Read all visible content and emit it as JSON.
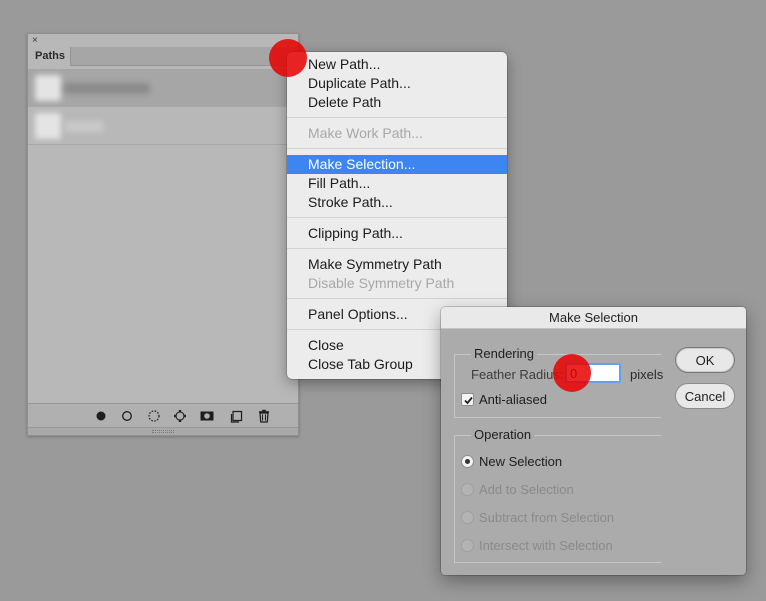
{
  "panel": {
    "close_glyph": "×",
    "tab_label": "Paths",
    "footer_icons": [
      "fill-path-icon",
      "stroke-path-icon",
      "load-selection-icon",
      "make-work-path-icon",
      "add-mask-icon",
      "new-path-icon",
      "trash-icon"
    ]
  },
  "menu": {
    "items": [
      {
        "label": "New Path...",
        "state": "normal"
      },
      {
        "label": "Duplicate Path...",
        "state": "normal"
      },
      {
        "label": "Delete Path",
        "state": "normal"
      },
      {
        "label": "Make Work Path...",
        "state": "disabled"
      },
      {
        "label": "Make Selection...",
        "state": "highlighted"
      },
      {
        "label": "Fill Path...",
        "state": "normal"
      },
      {
        "label": "Stroke Path...",
        "state": "normal"
      },
      {
        "label": "Clipping Path...",
        "state": "normal"
      },
      {
        "label": "Make Symmetry Path",
        "state": "normal"
      },
      {
        "label": "Disable Symmetry Path",
        "state": "disabled"
      },
      {
        "label": "Panel Options...",
        "state": "normal"
      },
      {
        "label": "Close",
        "state": "normal"
      },
      {
        "label": "Close Tab Group",
        "state": "normal"
      }
    ]
  },
  "dialog": {
    "title": "Make Selection",
    "rendering": {
      "legend": "Rendering",
      "feather_label": "Feather Radius:",
      "feather_value": "0",
      "unit": "pixels",
      "anti_aliased_label": "Anti-aliased",
      "anti_aliased_checked": true
    },
    "operation": {
      "legend": "Operation",
      "options": [
        {
          "label": "New Selection",
          "checked": true,
          "enabled": true
        },
        {
          "label": "Add to Selection",
          "checked": false,
          "enabled": false
        },
        {
          "label": "Subtract from Selection",
          "checked": false,
          "enabled": false
        },
        {
          "label": "Intersect with Selection",
          "checked": false,
          "enabled": false
        }
      ]
    },
    "ok_label": "OK",
    "cancel_label": "Cancel"
  },
  "colors": {
    "highlight": "#3d86f2",
    "click_marker": "#e60000"
  }
}
